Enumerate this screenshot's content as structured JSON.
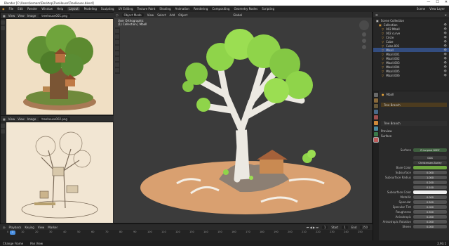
{
  "window": {
    "title": "Blender [C:\\Users\\kemaro\\Desktop\\TreeHouse\\TreeHouse.blend]",
    "controls": [
      "—",
      "☐",
      "✕"
    ]
  },
  "menu": {
    "items": [
      "File",
      "Edit",
      "Render",
      "Window",
      "Help"
    ],
    "workspaces": [
      "Layout",
      "Modeling",
      "Sculpting",
      "UV Editing",
      "Texture Paint",
      "Shading",
      "Animation",
      "Rendering",
      "Compositing",
      "Geometry Nodes",
      "Scripting"
    ],
    "active_workspace": "Layout",
    "scene_label": "Scene",
    "viewlayer_label": "View Layer"
  },
  "image_editor_top": {
    "menus": [
      "View",
      "View",
      "Image"
    ],
    "filename": "treehouse001.png"
  },
  "image_editor_bottom": {
    "menus": [
      "View",
      "View",
      "Image"
    ],
    "filename": "treehouse002.png"
  },
  "viewport": {
    "mode": "Object Mode",
    "menus": [
      "View",
      "Select",
      "Add",
      "Object"
    ],
    "orientation": "Global",
    "info_line1": "User Orthographic",
    "info_line2": "(1) Collection | Mball"
  },
  "outliner": {
    "root": "Scene Collection",
    "items": [
      "Collection",
      "002 Mball",
      "002 curve",
      "Circle",
      "Cube",
      "Cube.001",
      "Mball",
      "Mball.001",
      "Mball.002",
      "Mball.003",
      "Mball.004",
      "Mball.005",
      "Mball.006"
    ],
    "selected_index": 6
  },
  "properties": {
    "object": "Mball",
    "material_slot": "Tree Branch",
    "material_name": "Tree Branch",
    "panels": [
      "Preview",
      "Surface"
    ],
    "shader": "Principled BSDF",
    "surface_label": "Surface",
    "rows": [
      {
        "label": "",
        "value": "GGX"
      },
      {
        "label": "",
        "value": "Christensen-Burley"
      },
      {
        "label": "Base Color",
        "value": ""
      },
      {
        "label": "Subsurface",
        "value": "0.000"
      },
      {
        "label": "Subsurface Radius",
        "value": "1.000"
      },
      {
        "label": "",
        "value": "0.200"
      },
      {
        "label": "",
        "value": "0.100"
      },
      {
        "label": "Subsurface Color",
        "value": ""
      },
      {
        "label": "Metallic",
        "value": "0.000"
      },
      {
        "label": "Specular",
        "value": "0.500"
      },
      {
        "label": "Specular Tint",
        "value": "0.000"
      },
      {
        "label": "Roughness",
        "value": "0.500"
      },
      {
        "label": "Anisotropic",
        "value": "0.000"
      },
      {
        "label": "Anisotropic Rotation",
        "value": "0.000"
      },
      {
        "label": "Sheen",
        "value": "0.000"
      }
    ]
  },
  "timeline": {
    "menus": [
      "Playback",
      "Keying",
      "View",
      "Marker"
    ],
    "current_frame": "1",
    "start_label": "Start",
    "start": "1",
    "end_label": "End",
    "end": "250",
    "ticks": [
      "0",
      "10",
      "20",
      "30",
      "40",
      "50",
      "60",
      "70",
      "80",
      "90",
      "100",
      "110",
      "120",
      "130",
      "140",
      "150",
      "160",
      "170",
      "180",
      "190",
      "200",
      "210",
      "220",
      "230",
      "240",
      "250"
    ]
  },
  "status": {
    "items": [
      "Change Frame",
      "Pan View"
    ],
    "version": "2.93.1"
  },
  "colors": {
    "accent_orange": "#e6a33a",
    "selection_blue": "#334d80",
    "leaf_green": "#8fd44a",
    "branch_white": "#ece9e2",
    "ground_tan": "#d9a070"
  }
}
